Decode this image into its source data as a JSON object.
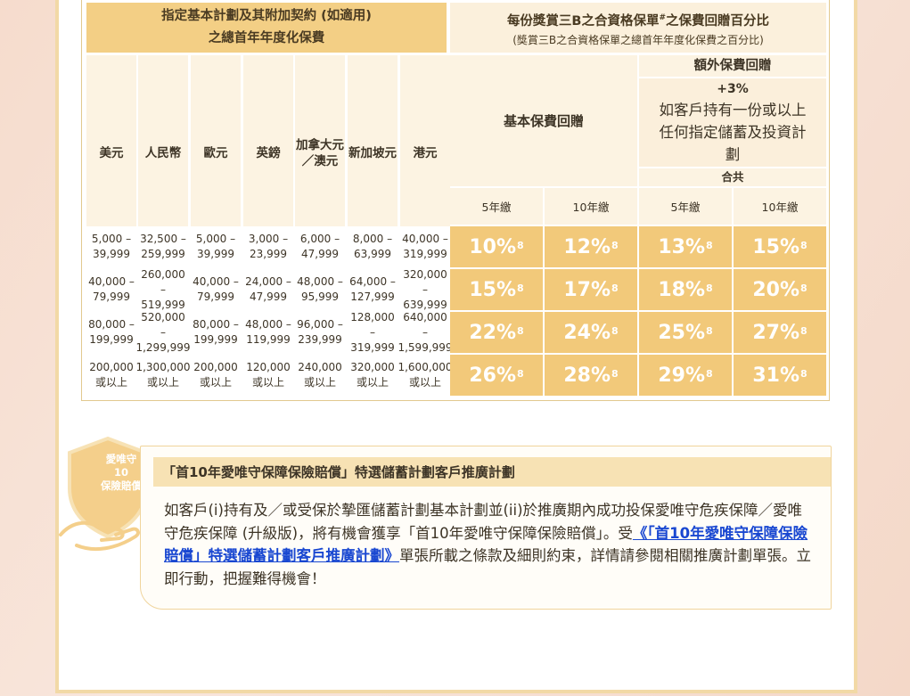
{
  "header": {
    "left_title": "指定基本計劃及其附加契約 (如適用)",
    "left_subtitle": "之總首年年度化保費",
    "right_title": "每份獎賞三B之合資格保單",
    "right_title_mark": "#",
    "right_title_end": "之保費回贈百分比",
    "right_subtitle": "(獎賞三B之合資格保單之總首年年度化保費之百分比)",
    "basic_rebate": "基本保費回贈",
    "extra_rebate": "額外保費回贈",
    "extra_plus": "+3%",
    "extra_desc": "如客戶持有一份或以上任何指定儲蓄及投資計劃",
    "total": "合共"
  },
  "currencies": [
    "美元",
    "人民幣",
    "歐元",
    "英鎊",
    "加拿大元／澳元",
    "新加坡元",
    "港元"
  ],
  "pay_terms": [
    "5年繳",
    "10年繳",
    "5年繳",
    "10年繳"
  ],
  "rows": [
    {
      "amounts": [
        [
          "5,000 –",
          "39,999"
        ],
        [
          "32,500 –",
          "259,999"
        ],
        [
          "5,000 –",
          "39,999"
        ],
        [
          "3,000 –",
          "23,999"
        ],
        [
          "6,000 –",
          "47,999"
        ],
        [
          "8,000 –",
          "63,999"
        ],
        [
          "40,000 –",
          "319,999"
        ]
      ],
      "rates": [
        "10%",
        "12%",
        "13%",
        "15%"
      ]
    },
    {
      "amounts": [
        [
          "40,000 –",
          "79,999"
        ],
        [
          "260,000 –",
          "519,999"
        ],
        [
          "40,000 –",
          "79,999"
        ],
        [
          "24,000 –",
          "47,999"
        ],
        [
          "48,000 –",
          "95,999"
        ],
        [
          "64,000 –",
          "127,999"
        ],
        [
          "320,000 –",
          "639,999"
        ]
      ],
      "rates": [
        "15%",
        "17%",
        "18%",
        "20%"
      ]
    },
    {
      "amounts": [
        [
          "80,000 –",
          "199,999"
        ],
        [
          "520,000 –",
          "1,299,999"
        ],
        [
          "80,000 –",
          "199,999"
        ],
        [
          "48,000 –",
          "119,999"
        ],
        [
          "96,000 –",
          "239,999"
        ],
        [
          "128,000 –",
          "319,999"
        ],
        [
          "640,000 –",
          "1,599,999"
        ]
      ],
      "rates": [
        "22%",
        "24%",
        "25%",
        "27%"
      ]
    },
    {
      "amounts": [
        [
          "200,000",
          "或以上"
        ],
        [
          "1,300,000",
          "或以上"
        ],
        [
          "200,000",
          "或以上"
        ],
        [
          "120,000",
          "或以上"
        ],
        [
          "240,000",
          "或以上"
        ],
        [
          "320,000",
          "或以上"
        ],
        [
          "1,600,000",
          "或以上"
        ]
      ],
      "rates": [
        "26%",
        "28%",
        "29%",
        "31%"
      ]
    }
  ],
  "footnote_mark": "8",
  "promo": {
    "badge_line1": "愛唯守",
    "badge_line2": "10",
    "badge_line3": "保險賠償",
    "title": "「首10年愛唯守保障保險賠償」特選儲蓄計劃客戶推廣計劃",
    "text_before": "如客戶(i)持有及／或受保於摯匯儲蓄計劃基本計劃並(ii)於推廣期內成功投保愛唯守危疾保障／愛唯守危疾保障 (升級版)，將有機會獲享「首10年愛唯守保障保險賠償」。受",
    "link": "《「首10年愛唯守保障保險賠償」特選儲蓄計劃客戶推廣計劃》",
    "text_after": "單張所載之條款及細則約束，詳情請參閱相關推廣計劃單張。立即行動，把握難得機會！"
  },
  "colors": {
    "gold": "#f3cf85",
    "rate_cell": "#f2c97a",
    "cream": "#fcf3e2",
    "link": "#1947d1"
  }
}
